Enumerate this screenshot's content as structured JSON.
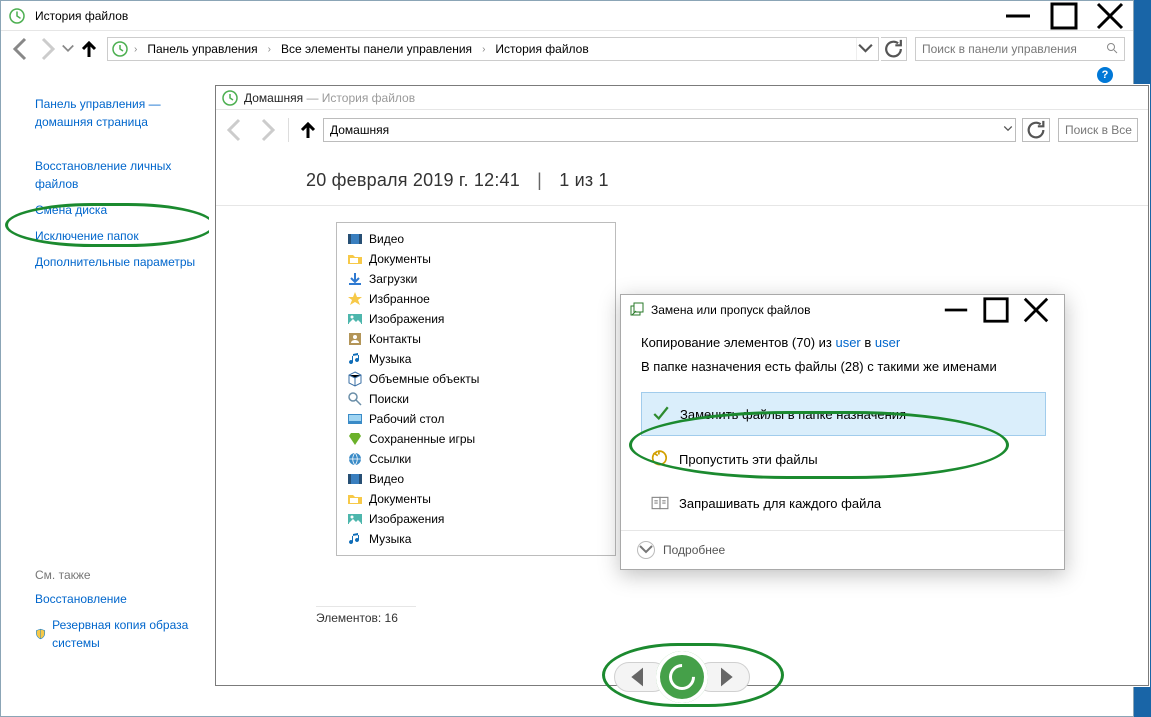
{
  "outer": {
    "title": "История файлов",
    "breadcrumbs": [
      "Панель управления",
      "Все элементы панели управления",
      "История файлов"
    ],
    "search_placeholder": "Поиск в панели управления"
  },
  "sidebar": {
    "home": "Панель управления — домашняя страница",
    "links": [
      "Восстановление личных файлов",
      "Смена диска",
      "Исключение папок",
      "Дополнительные параметры"
    ],
    "see_also_header": "См. также",
    "see_also": [
      "Восстановление",
      "Резервная копия образа системы"
    ]
  },
  "inner": {
    "title_main": "Домашняя",
    "title_sep": " — ",
    "title_sub": "История файлов",
    "path_value": "Домашняя",
    "search_placeholder": "Поиск в Все",
    "date_text": "20 февраля 2019 г. 12:41",
    "page_text": "1 из 1",
    "folders": [
      {
        "icon": "video",
        "label": "Видео"
      },
      {
        "icon": "folder",
        "label": "Документы"
      },
      {
        "icon": "download",
        "label": "Загрузки"
      },
      {
        "icon": "star",
        "label": "Избранное"
      },
      {
        "icon": "pictures",
        "label": "Изображения"
      },
      {
        "icon": "contacts",
        "label": "Контакты"
      },
      {
        "icon": "music",
        "label": "Музыка"
      },
      {
        "icon": "cube",
        "label": "Объемные объекты"
      },
      {
        "icon": "search",
        "label": "Поиски"
      },
      {
        "icon": "desktop",
        "label": "Рабочий стол"
      },
      {
        "icon": "savedgames",
        "label": "Сохраненные игры"
      },
      {
        "icon": "links",
        "label": "Ссылки"
      },
      {
        "icon": "video",
        "label": "Видео"
      },
      {
        "icon": "folder",
        "label": "Документы"
      },
      {
        "icon": "pictures",
        "label": "Изображения"
      },
      {
        "icon": "music",
        "label": "Музыка"
      }
    ],
    "footer": "Элементов: 16"
  },
  "dialog": {
    "title": "Замена или пропуск файлов",
    "copying_prefix": "Копирование элементов (70) из ",
    "copying_from": "user",
    "copying_mid": " в ",
    "copying_to": "user",
    "conflict": "В папке назначения есть файлы (28) с такими же именами",
    "options": {
      "replace": "Заменить файлы в папке назначения",
      "skip": "Пропустить эти файлы",
      "decide": "Запрашивать для каждого файла"
    },
    "more": "Подробнее"
  }
}
